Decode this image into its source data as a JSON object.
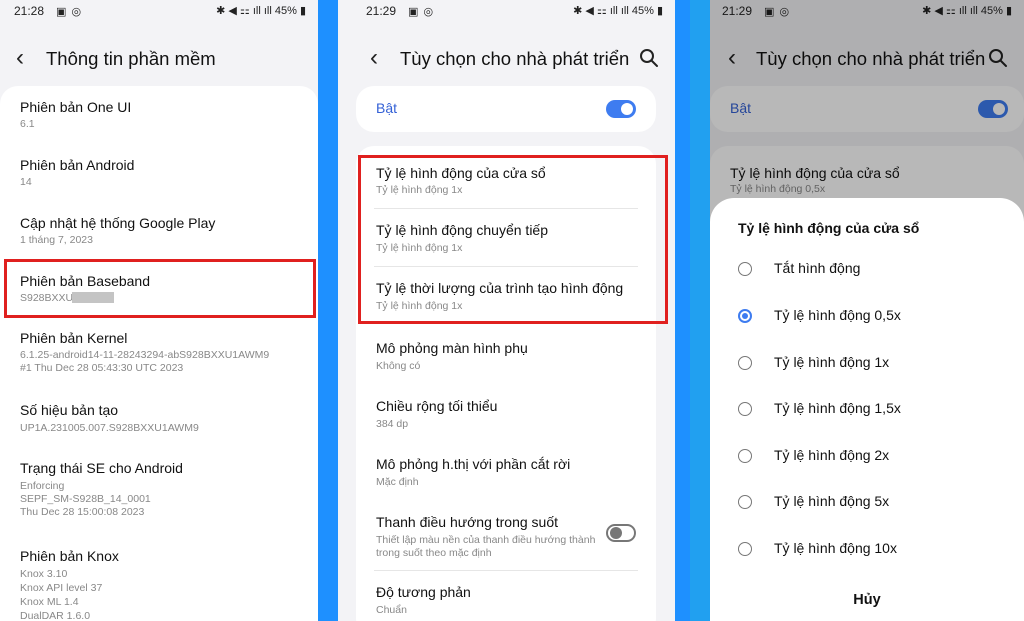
{
  "status": {
    "p1": {
      "time": "21:28",
      "right": "45%"
    },
    "p2": {
      "time": "21:29",
      "right": "45%"
    },
    "p3": {
      "time": "21:29",
      "right": "45%"
    }
  },
  "software_info": {
    "title": "Thông tin phần mềm",
    "items": [
      {
        "title": "Phiên bản One UI",
        "sub": [
          "6.1"
        ]
      },
      {
        "title": "Phiên bản Android",
        "sub": [
          "14"
        ]
      },
      {
        "title": "Cập nhật hệ thống Google Play",
        "sub": [
          "1 tháng 7, 2023"
        ]
      },
      {
        "title": "Phiên bản Baseband",
        "sub": [
          "S928BXXU"
        ]
      },
      {
        "title": "Phiên bản Kernel",
        "sub": [
          "6.1.25-android14-11-28243294-abS928BXXU1AWM9",
          "#1 Thu Dec 28 05:43:30 UTC 2023"
        ]
      },
      {
        "title": "Số hiệu bản tạo",
        "sub": [
          "UP1A.231005.007.S928BXXU1AWM9"
        ]
      },
      {
        "title": "Trạng thái SE cho Android",
        "sub": [
          "Enforcing",
          "SEPF_SM-S928B_14_0001",
          "Thu Dec 28 15:00:08 2023"
        ]
      },
      {
        "title": "Phiên bản Knox",
        "sub": [
          "Knox 3.10",
          "Knox API level 37",
          "Knox ML 1.4",
          "DualDAR 1.6.0"
        ]
      }
    ]
  },
  "dev_options": {
    "title": "Tùy chọn cho nhà phát triển",
    "toggle_label": "Bật",
    "items": [
      {
        "title": "Tỷ lệ hình động của cửa sổ",
        "sub": [
          "Tỷ lệ hình động 1x"
        ]
      },
      {
        "title": "Tỷ lệ hình động chuyển tiếp",
        "sub": [
          "Tỷ lệ hình động 1x"
        ]
      },
      {
        "title": "Tỷ lệ thời lượng của trình tạo hình động",
        "sub": [
          "Tỷ lệ hình động 1x"
        ]
      },
      {
        "title": "Mô phỏng màn hình phụ",
        "sub": [
          "Không có"
        ]
      },
      {
        "title": "Chiều rộng tối thiểu",
        "sub": [
          "384 dp"
        ]
      },
      {
        "title": "Mô phỏng h.thị với phần cắt rời",
        "sub": [
          "Mặc định"
        ]
      },
      {
        "title": "Thanh điều hướng trong suốt",
        "sub": [
          "Thiết lập màu nền của thanh điều hướng thành",
          "trong suốt theo mặc định"
        ]
      },
      {
        "title": "Độ tương phản",
        "sub": [
          "Chuẩn"
        ]
      }
    ]
  },
  "dev_options_dialog": {
    "title": "Tùy chọn cho nhà phát triển",
    "toggle_label": "Bật",
    "bg_item": {
      "title": "Tỷ lệ hình động của cửa sổ",
      "sub": "Tỷ lệ hình động 0,5x"
    },
    "sheet_title": "Tỷ lệ hình động của cửa sổ",
    "options": [
      "Tắt hình động",
      "Tỷ lệ hình động 0,5x",
      "Tỷ lệ hình động 1x",
      "Tỷ lệ hình động 1,5x",
      "Tỷ lệ hình động 2x",
      "Tỷ lệ hình động 5x",
      "Tỷ lệ hình động 10x"
    ],
    "selected_index": 1,
    "cancel_label": "Hủy"
  }
}
